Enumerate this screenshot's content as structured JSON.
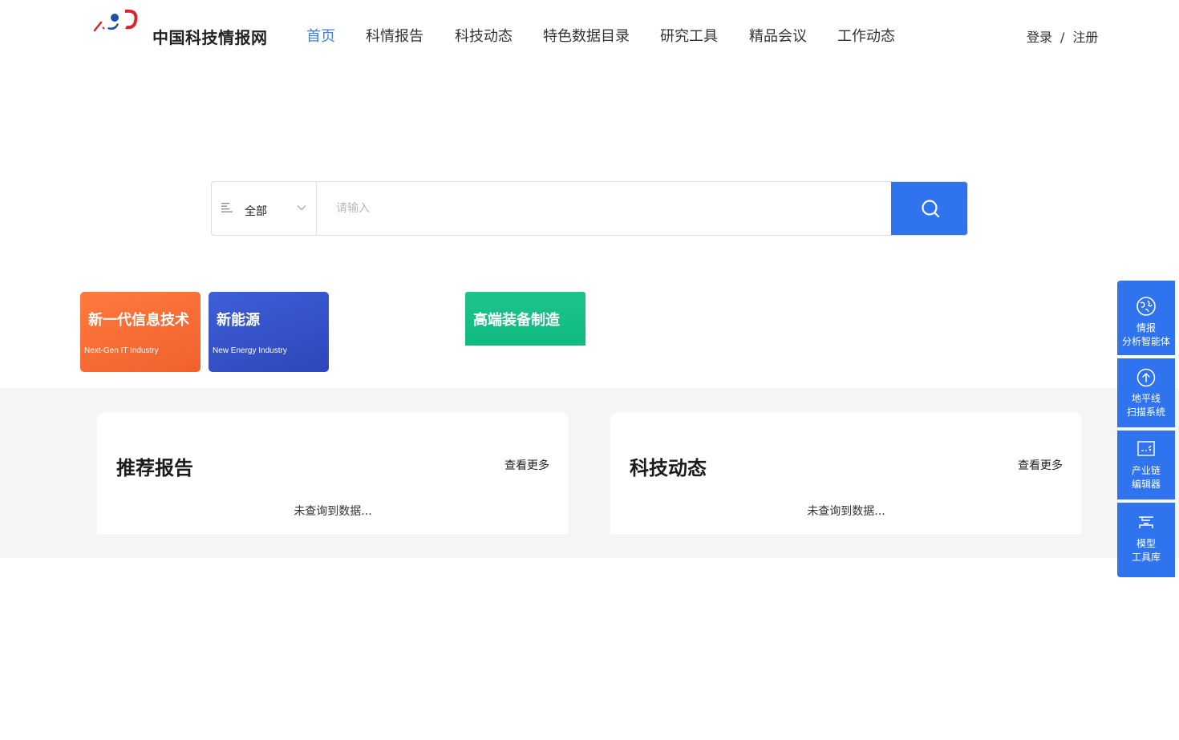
{
  "header": {
    "site_name": "中国科技情报网",
    "nav": [
      {
        "label": "首页",
        "active": true
      },
      {
        "label": "科情报告",
        "active": false
      },
      {
        "label": "科技动态",
        "active": false
      },
      {
        "label": "特色数据目录",
        "active": false
      },
      {
        "label": "研究工具",
        "active": false
      },
      {
        "label": "精品会议",
        "active": false
      },
      {
        "label": "工作动态",
        "active": false
      }
    ],
    "login_label": "登录",
    "separator": "/",
    "register_label": "注册"
  },
  "search": {
    "type_value": "全部",
    "placeholder": "请输入",
    "value": ""
  },
  "industries": [
    {
      "title": "新一代信息技术",
      "subtitle": "Next-Gen IT Industry"
    },
    {
      "title": "新能源",
      "subtitle": "New Energy Industry"
    },
    {
      "title": "高端装备制造",
      "subtitle": ""
    }
  ],
  "panels": {
    "reports": {
      "title": "推荐报告",
      "more": "查看更多",
      "empty": "未查询到数据..."
    },
    "tech": {
      "title": "科技动态",
      "more": "查看更多",
      "empty": "未查询到数据..."
    }
  },
  "sidebar": [
    {
      "line1": "情报",
      "line2": "分析智能体",
      "icon": "globe-icon"
    },
    {
      "line1": "地平线",
      "line2": "扫描系统",
      "icon": "upload-circle-icon"
    },
    {
      "line1": "产业链",
      "line2": "编辑器",
      "icon": "chain-editor-icon"
    },
    {
      "line1": "模型",
      "line2": "工具库",
      "icon": "model-toolbox-icon"
    }
  ],
  "colors": {
    "accent": "#2f74ee",
    "nav_active": "#3b7fe6",
    "card_it": "#f0602e",
    "card_new_energy": "#2d47b8",
    "card_high_end": "#10b97f",
    "content_bg": "#f4f5f7"
  }
}
